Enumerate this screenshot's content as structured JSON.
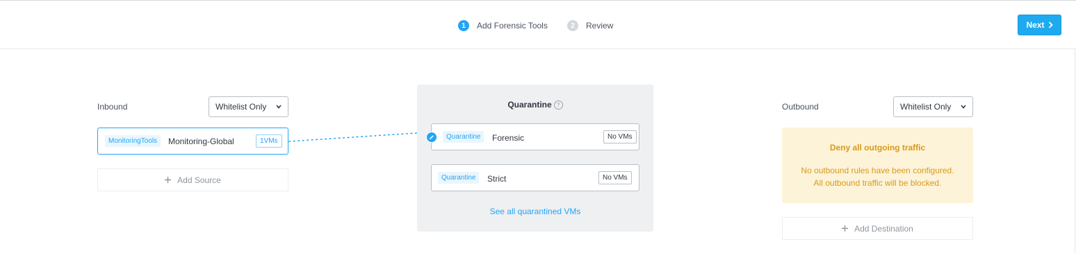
{
  "steps": [
    {
      "number": "1",
      "label": "Add Forensic Tools",
      "active": true
    },
    {
      "number": "2",
      "label": "Review",
      "active": false
    }
  ],
  "next_button": {
    "label": "Next"
  },
  "inbound": {
    "label": "Inbound",
    "dropdown_value": "Whitelist Only",
    "sources": [
      {
        "tag": "MonitoringTools",
        "name": "Monitoring-Global",
        "vm_count": "1VMs"
      }
    ],
    "add_label": "Add Source"
  },
  "quarantine": {
    "title": "Quarantine",
    "help_glyph": "?",
    "policies": [
      {
        "tag": "Quarantine",
        "name": "Forensic",
        "vm_count": "No VMs",
        "selected": true
      },
      {
        "tag": "Quarantine",
        "name": "Strict",
        "vm_count": "No VMs",
        "selected": false
      }
    ],
    "see_all_label": "See all quarantined VMs"
  },
  "outbound": {
    "label": "Outbound",
    "dropdown_value": "Whitelist Only",
    "deny_title": "Deny all outgoing traffic",
    "deny_line1": "No outbound rules have been configured.",
    "deny_line2": "All outbound traffic will be blocked.",
    "add_label": "Add Destination"
  },
  "colors": {
    "accent": "#22a5f7",
    "warning_bg": "#fdf3d8",
    "warning_text": "#d99a1a",
    "panel_bg": "#eff0f2"
  }
}
